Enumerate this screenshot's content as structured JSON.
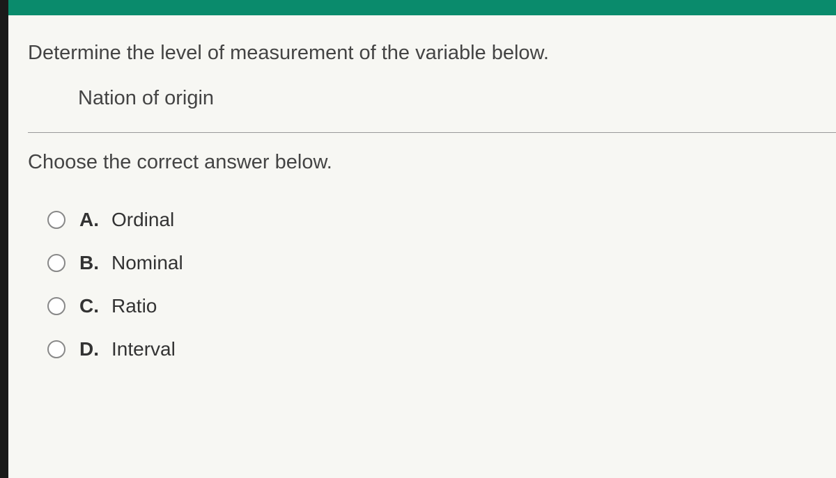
{
  "question": {
    "prompt": "Determine the level of measurement of the variable below.",
    "variable": "Nation of origin",
    "instruction": "Choose the correct answer below."
  },
  "options": [
    {
      "letter": "A.",
      "text": "Ordinal"
    },
    {
      "letter": "B.",
      "text": "Nominal"
    },
    {
      "letter": "C.",
      "text": "Ratio"
    },
    {
      "letter": "D.",
      "text": "Interval"
    }
  ]
}
